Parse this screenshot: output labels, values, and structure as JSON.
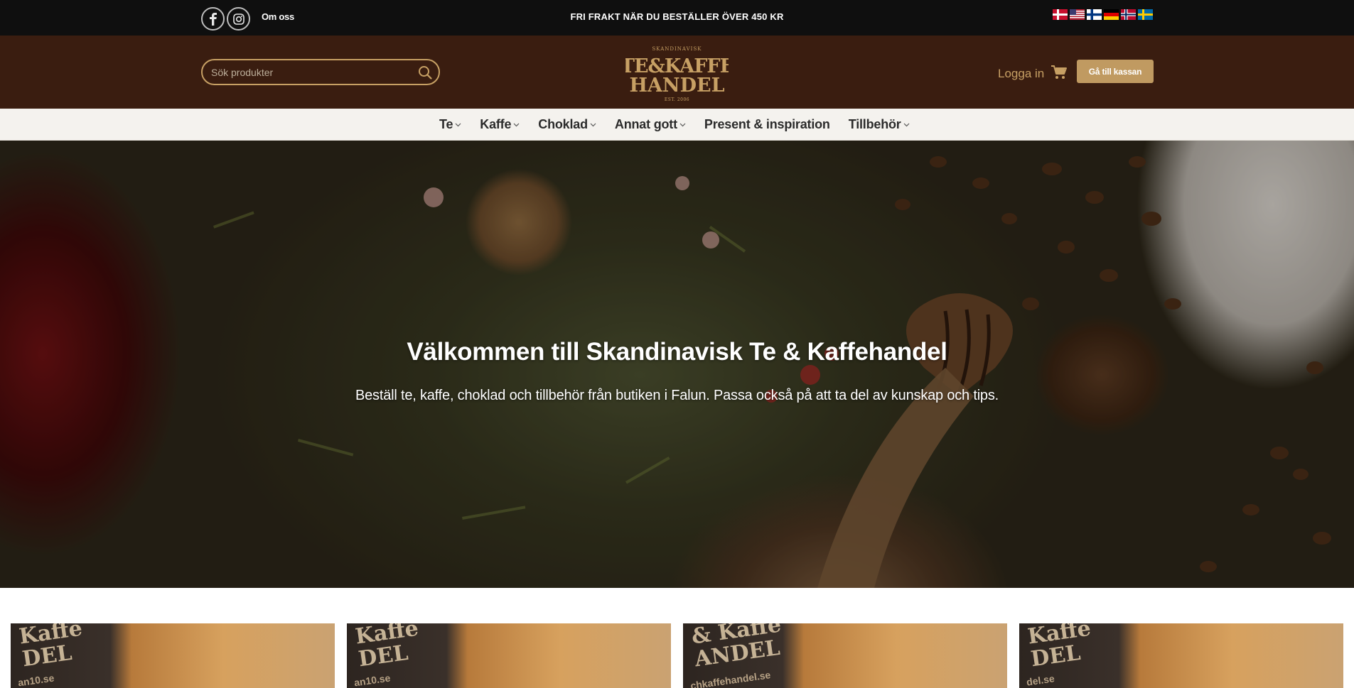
{
  "topbar": {
    "about_label": "Om oss",
    "shipping_notice": "FRI FRAKT NÄR DU BESTÄLLER ÖVER 450 KR",
    "social_icons": [
      "facebook-icon",
      "instagram-icon"
    ],
    "languages": [
      "danish-flag",
      "english-flag",
      "finnish-flag",
      "german-flag",
      "norwegian-flag",
      "swedish-flag"
    ]
  },
  "header": {
    "search_placeholder": "Sök produkter",
    "logo": {
      "top": "SKANDINAVISK",
      "line1": "TE&KAFFE",
      "line2": "HANDEL",
      "est": "EST. 2006"
    },
    "login_label": "Logga in",
    "checkout_label": "Gå till kassan"
  },
  "nav": {
    "items": [
      {
        "label": "Te",
        "dropdown": true
      },
      {
        "label": "Kaffe",
        "dropdown": true
      },
      {
        "label": "Choklad",
        "dropdown": true
      },
      {
        "label": "Annat gott",
        "dropdown": true
      },
      {
        "label": "Present & inspiration",
        "dropdown": false
      },
      {
        "label": "Tillbehör",
        "dropdown": true
      }
    ]
  },
  "hero": {
    "title": "Välkommen till Skandinavisk Te & Kaffehandel",
    "subtitle": "Beställ te, kaffe, choklad och tillbehör från butiken i Falun. Passa också på att ta del av kunskap och tips."
  },
  "cards": [
    {
      "label1": "Kaffe",
      "label2": "DEL",
      "url": "an10.se"
    },
    {
      "label1": "Kaffe",
      "label2": "DEL",
      "url": "an10.se"
    },
    {
      "label1": "& Kaffe",
      "label2": "ANDEL",
      "url": "chkaffehandel.se"
    },
    {
      "label1": "Kaffe",
      "label2": "DEL",
      "url": "del.se"
    }
  ],
  "colors": {
    "topbar_bg": "#0f0f0f",
    "header_bg": "#3a1d10",
    "accent_gold": "#c09a61",
    "nav_bg": "#f4f2ee"
  }
}
